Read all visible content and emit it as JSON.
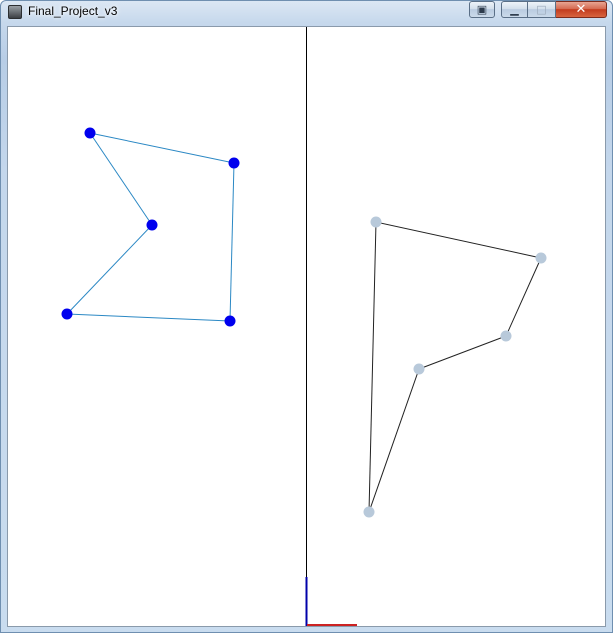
{
  "window": {
    "title": "Final_Project_v3",
    "icon": "app-icon"
  },
  "caption_buttons": {
    "extra_icon": "window-menu-icon",
    "minimize_icon": "minimize-icon",
    "maximize_icon": "maximize-icon",
    "close_icon": "close-icon"
  },
  "colors": {
    "left_point": "#0000ee",
    "left_edge": "#2b88c4",
    "right_point": "#b8c9da",
    "right_edge": "#222222",
    "divider": "#000000",
    "axis_vertical": "#0000aa",
    "axis_horizontal": "#cc2222"
  },
  "left_polygon": {
    "vertex_count": 5,
    "closed": true
  },
  "right_polygon": {
    "vertex_count": 5,
    "closed": true
  }
}
